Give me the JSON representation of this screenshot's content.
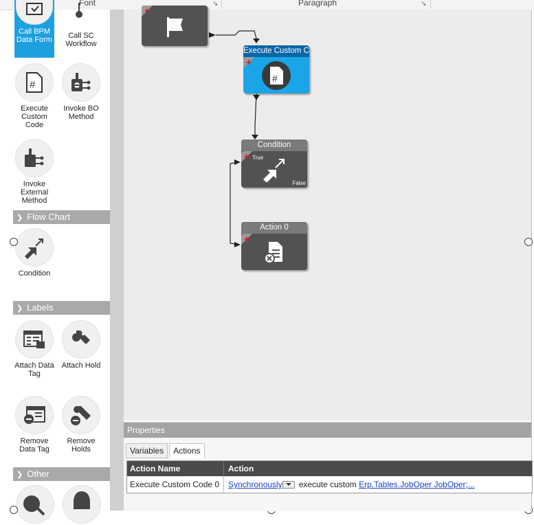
{
  "ribbon": {
    "font_label": "Font",
    "paragraph_label": "Paragraph"
  },
  "toolbox": {
    "tools": [
      {
        "label": "Call BPM Data Form",
        "icon": "form-icon",
        "selected": true
      },
      {
        "label": "Call SC Workflow",
        "icon": "workflow-icon"
      },
      {
        "label": "Execute Custom Code",
        "icon": "custom-code-icon"
      },
      {
        "label": "Invoke BO Method",
        "icon": "bo-method-icon"
      },
      {
        "label": "Invoke External Method",
        "icon": "external-method-icon"
      }
    ],
    "sections": [
      {
        "label": "Flow Chart",
        "items": [
          {
            "label": "Condition",
            "icon": "condition-icon"
          }
        ]
      },
      {
        "label": "Labels",
        "items": [
          {
            "label": "Attach Data Tag",
            "icon": "attach-data-tag-icon"
          },
          {
            "label": "Attach Hold",
            "icon": "attach-hold-icon"
          },
          {
            "label": "Remove Data Tag",
            "icon": "remove-data-tag-icon"
          },
          {
            "label": "Remove Holds",
            "icon": "remove-holds-icon"
          }
        ]
      },
      {
        "label": "Other",
        "items": []
      }
    ]
  },
  "canvas": {
    "nodes": [
      {
        "id": "start",
        "title": "",
        "icon": "flag-icon"
      },
      {
        "id": "exec",
        "title": "Execute Custom Code",
        "icon": "custom-code-icon",
        "selected": true
      },
      {
        "id": "cond",
        "title": "Condition",
        "icon": "condition-icon",
        "true_label": "True",
        "false_label": "False"
      },
      {
        "id": "act0",
        "title": "Action 0",
        "icon": "action-icon"
      }
    ]
  },
  "properties": {
    "title": "Properties",
    "tabs": [
      {
        "label": "Variables"
      },
      {
        "label": "Actions",
        "active": true
      }
    ],
    "columns": [
      "Action Name",
      "Action"
    ],
    "rows": [
      {
        "name": "Execute Custom Code 0",
        "mode": "Synchronously",
        "text": "execute custom",
        "link": "Erp.Tables.JobOper JobOper;..."
      }
    ]
  },
  "colors": {
    "selected": "#1aa5e8",
    "node": "#525252",
    "panel_header": "#a3a3a3"
  }
}
